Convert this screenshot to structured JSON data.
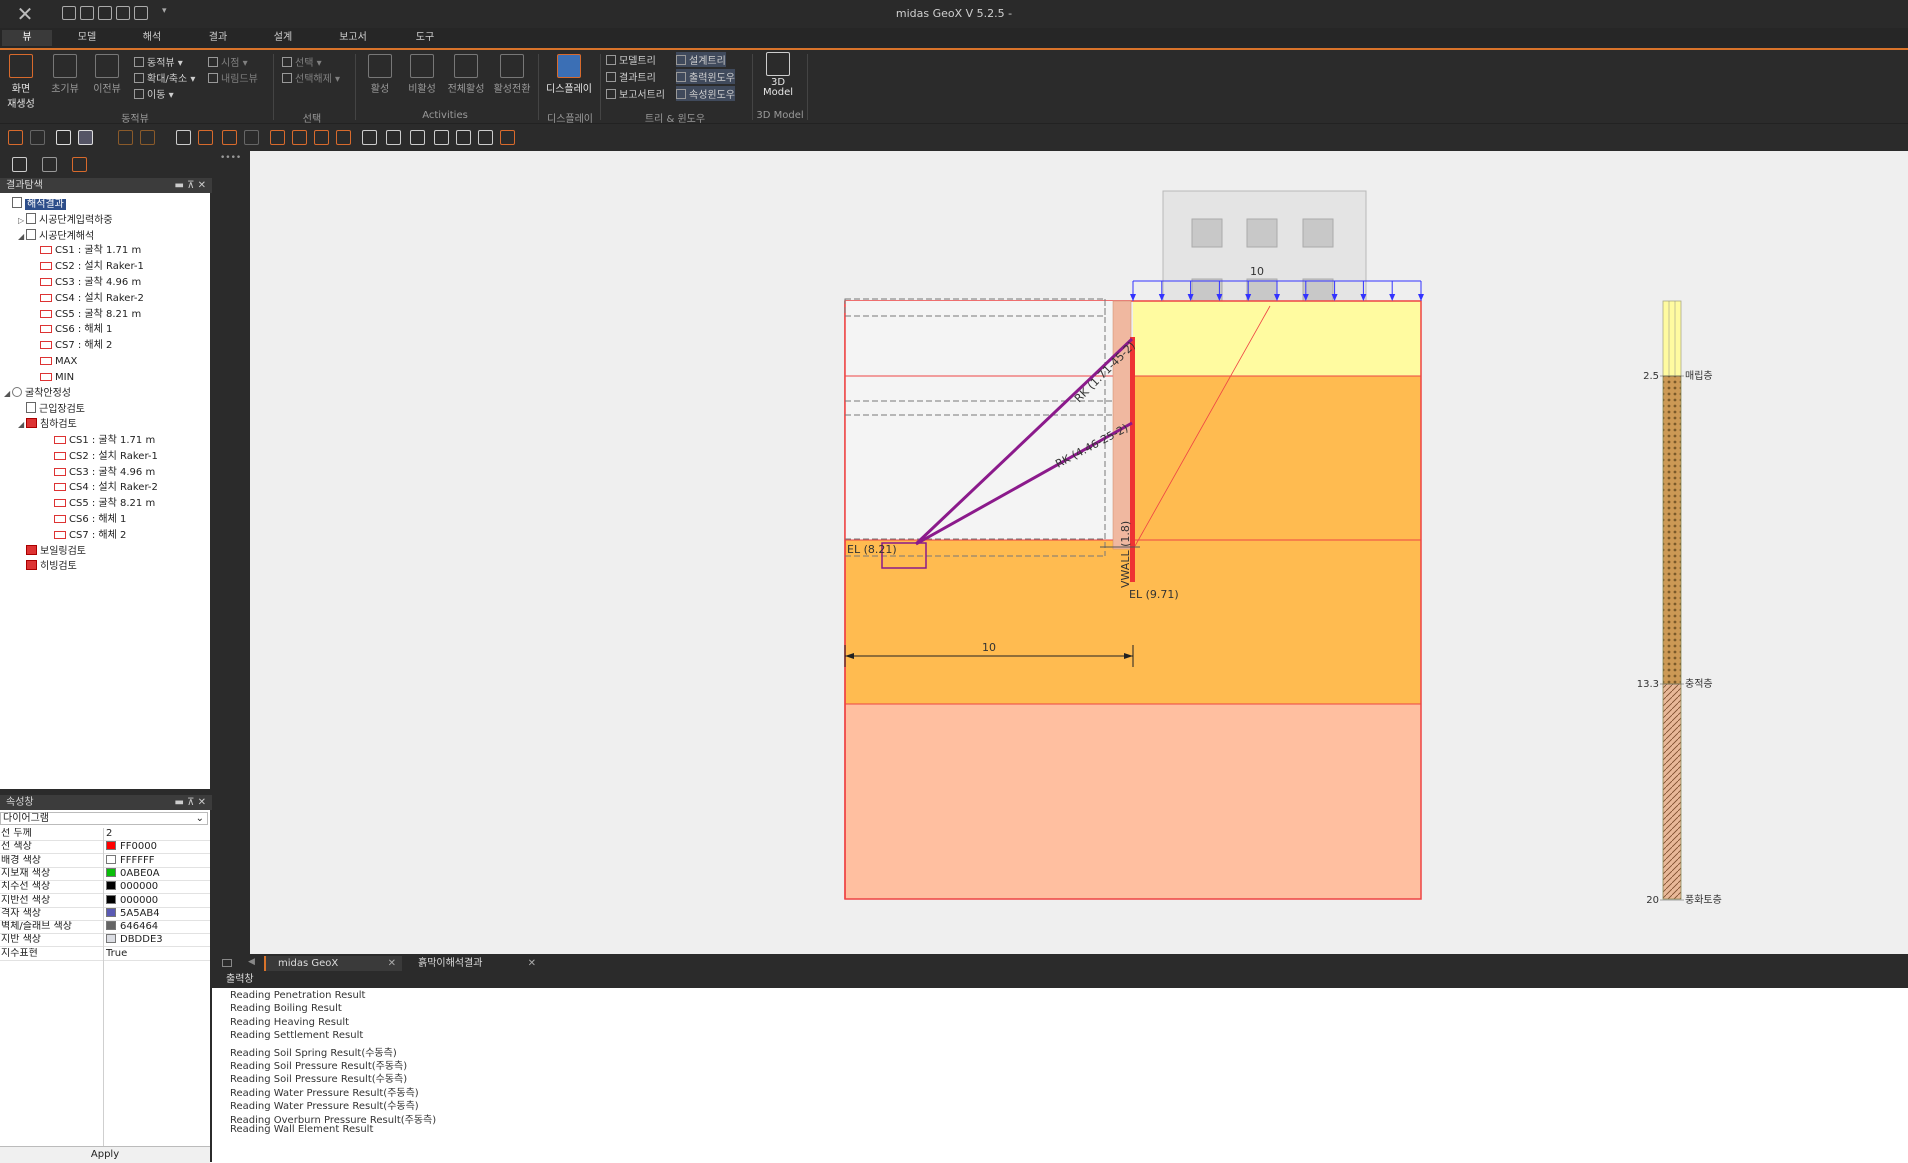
{
  "app": {
    "title": "midas GeoX V 5.2.5 -"
  },
  "menu": {
    "tabs": [
      "뷰",
      "모델",
      "해석",
      "결과",
      "설계",
      "보고서",
      "도구"
    ]
  },
  "ribbon": {
    "view_group": {
      "label": "동적뷰",
      "regen": "화면\n재생성",
      "initial": "초기뷰",
      "prev": "이전뷰",
      "dynamic": "동적뷰",
      "zoom": "확대/축소",
      "pan": "이동",
      "point_view": "시점",
      "internal_view": "내림드뷰"
    },
    "select_group": {
      "label": "선택",
      "select": "선택",
      "deselect": "선택해제"
    },
    "activities_group": {
      "label": "Activities",
      "activate": "활성",
      "deactivate": "비활성",
      "all_activate": "전체활성",
      "activate_all": "활성전환"
    },
    "display_group": {
      "label": "디스플레이",
      "display": "디스플레이"
    },
    "tree_group": {
      "label": "트리 & 윈도우",
      "model_tree": "모델트리",
      "design_tree": "설계트리",
      "result_tree": "결과트리",
      "output_window": "출력윈도우",
      "report_tree": "보고서트리",
      "property_window": "속성윈도우"
    },
    "model3d_group": {
      "label": "3D Model",
      "button": "3D\nModel"
    }
  },
  "left_panel": {
    "title": "결과탐색",
    "tree": [
      {
        "label": "해석결과",
        "level": 0,
        "icon": "doc",
        "selected": true
      },
      {
        "label": "시공단계입력하중",
        "level": 1,
        "icon": "doc",
        "exp": "▷"
      },
      {
        "label": "시공단계해석",
        "level": 1,
        "icon": "doc",
        "exp": "◢"
      },
      {
        "label": "CS1 : 굴착 1.71 m",
        "level": 2,
        "icon": "cs"
      },
      {
        "label": "CS2 : 설치 Raker-1",
        "level": 2,
        "icon": "cs"
      },
      {
        "label": "CS3 : 굴착 4.96 m",
        "level": 2,
        "icon": "cs"
      },
      {
        "label": "CS4 : 설치 Raker-2",
        "level": 2,
        "icon": "cs"
      },
      {
        "label": "CS5 : 굴착 8.21 m",
        "level": 2,
        "icon": "cs"
      },
      {
        "label": "CS6 : 해체 1",
        "level": 2,
        "icon": "cs"
      },
      {
        "label": "CS7 : 해체 2",
        "level": 2,
        "icon": "cs"
      },
      {
        "label": "MAX",
        "level": 2,
        "icon": "cs"
      },
      {
        "label": "MIN",
        "level": 2,
        "icon": "cs"
      },
      {
        "label": "굴착안정성",
        "level": 0,
        "icon": "gear",
        "exp": "◢"
      },
      {
        "label": "근입장검토",
        "level": 1,
        "icon": "doc"
      },
      {
        "label": "침하검토",
        "level": 1,
        "icon": "red",
        "exp": "◢"
      },
      {
        "label": "CS1 : 굴착 1.71 m",
        "level": 3,
        "icon": "cs"
      },
      {
        "label": "CS2 : 설치 Raker-1",
        "level": 3,
        "icon": "cs"
      },
      {
        "label": "CS3 : 굴착 4.96 m",
        "level": 3,
        "icon": "cs"
      },
      {
        "label": "CS4 : 설치 Raker-2",
        "level": 3,
        "icon": "cs"
      },
      {
        "label": "CS5 : 굴착 8.21 m",
        "level": 3,
        "icon": "cs"
      },
      {
        "label": "CS6 : 해체 1",
        "level": 3,
        "icon": "cs"
      },
      {
        "label": "CS7 : 해체 2",
        "level": 3,
        "icon": "cs"
      },
      {
        "label": "보일링검토",
        "level": 1,
        "icon": "red"
      },
      {
        "label": "히빙검토",
        "level": 1,
        "icon": "red"
      }
    ]
  },
  "properties": {
    "title": "속성창",
    "dropdown": "다이어그램",
    "rows": [
      {
        "key": "선 두께",
        "value": "2",
        "color": ""
      },
      {
        "key": "선 색상",
        "value": "FF0000",
        "color": "#FF0000"
      },
      {
        "key": "배경 색상",
        "value": "FFFFFF",
        "color": "#FFFFFF"
      },
      {
        "key": "지보재 색상",
        "value": "0ABE0A",
        "color": "#0ABE0A"
      },
      {
        "key": "치수선 색상",
        "value": "000000",
        "color": "#000000"
      },
      {
        "key": "지반선 색상",
        "value": "000000",
        "color": "#000000"
      },
      {
        "key": "격자 색상",
        "value": "5A5AB4",
        "color": "#5A5AB4"
      },
      {
        "key": "벽체/슬래브 색상",
        "value": "646464",
        "color": "#646464"
      },
      {
        "key": "지반 색상",
        "value": "DBDDE3",
        "color": "#DBDDE3"
      },
      {
        "key": "지수표현",
        "value": "True",
        "color": ""
      }
    ],
    "apply": "Apply"
  },
  "canvas": {
    "surcharge_label": "10",
    "dim_label": "10",
    "raker1_label": "RK (1.71-45-2)",
    "raker2_label": "RK (4.46-25-2)",
    "wall_label": "VWALL (1.8)",
    "el_left": "EL (8.21)",
    "el_right": "EL (9.71)",
    "legend": [
      {
        "depth": "2.5",
        "name": "매립층"
      },
      {
        "depth": "13.3",
        "name": "충적층"
      },
      {
        "depth": "20",
        "name": "풍화토층"
      }
    ]
  },
  "doc_tabs": [
    "midas GeoX",
    "흙막이해석결과"
  ],
  "output": {
    "title": "출력창",
    "lines": [
      "Reading Penetration Result",
      "Reading Boiling Result",
      "Reading Heaving Result",
      "Reading Settlement Result",
      "Reading Soil Spring Result(수동측)",
      "Reading Soil Pressure Result(주동측)",
      "Reading Soil Pressure Result(수동측)",
      "Reading Water Pressure Result(주동측)",
      "Reading Water Pressure Result(수동측)",
      "Reading Overburn Pressure Result(주동측)",
      "Reading Wall Element Result"
    ]
  },
  "colors": {
    "accent": "#d9732a",
    "fill_layer": "#fffba0",
    "alluvial": "#ffbb50",
    "weathered": "#ffbfa0",
    "raker": "#8b1a8b",
    "wall": "#ee4444"
  }
}
